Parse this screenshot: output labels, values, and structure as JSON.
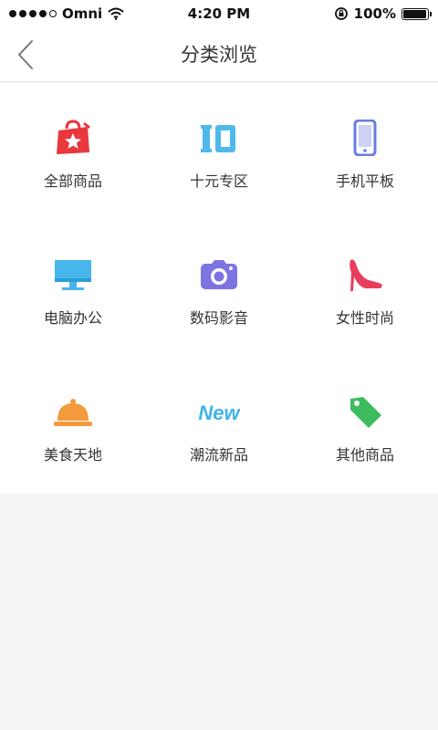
{
  "status_bar": {
    "carrier": "Omni",
    "time": "4:20 PM",
    "battery": "100%",
    "battery_level": 1.0
  },
  "nav": {
    "title": "分类浏览",
    "back_icon": "chevron-left-icon"
  },
  "categories": [
    {
      "label": "全部商品",
      "icon": "shopping-bag-star-icon",
      "color": "#e8373d"
    },
    {
      "label": "十元专区",
      "icon": "ten-number-icon",
      "color": "#4fb9ec"
    },
    {
      "label": "手机平板",
      "icon": "phone-icon",
      "color": "#6a7de0"
    },
    {
      "label": "电脑办公",
      "icon": "monitor-icon",
      "color": "#47b6ea"
    },
    {
      "label": "数码影音",
      "icon": "camera-icon",
      "color": "#7d74e2"
    },
    {
      "label": "女性时尚",
      "icon": "high-heel-icon",
      "color": "#ea3d5b"
    },
    {
      "label": "美食天地",
      "icon": "food-cloche-icon",
      "color": "#f29a3c"
    },
    {
      "label": "潮流新品",
      "icon": "new-badge-icon",
      "color": "#3fb2ea"
    },
    {
      "label": "其他商品",
      "icon": "price-tag-icon",
      "color": "#3dbb5f"
    }
  ]
}
